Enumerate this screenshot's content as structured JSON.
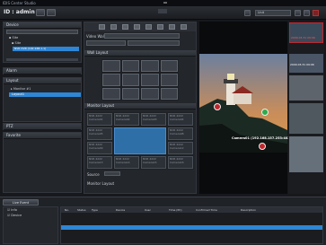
{
  "app": {
    "title": "IDIS Center Studio"
  },
  "topbar": {
    "id_label": "ID : admin",
    "user_value": "Unit"
  },
  "device_panel": {
    "title": "Device",
    "items": [
      {
        "label": "Site"
      },
      {
        "label": "Site"
      },
      {
        "label": "NVR DVR (192.168.1.1)"
      }
    ]
  },
  "side_sections": {
    "alarm": "Alarm",
    "layout": "Layout",
    "layout_items": [
      "Monitor #1",
      "Layout1"
    ],
    "ptz": "PTZ",
    "favorite": "Favorite"
  },
  "video_wall": {
    "label": "Video Wall",
    "layout_label": "Wall Layout"
  },
  "monitor_layout": {
    "label": "Monitor Layout",
    "cells": [
      "NVR 4222 Camera01",
      "NVR 4222 Camera02",
      "NVR 4222 Camera03",
      "NVR 4222 Camera04",
      "NVR 4222 Camera05",
      "",
      "",
      "NVR 4222 Camera08",
      "NVR 4222 Camera09",
      "",
      "",
      "NVR 4222 Camera12",
      "NVR 4222 Camera13",
      "NVR 4222 Camera14",
      "NVR 4222 Camera15",
      "NVR 4222 Camera16"
    ]
  },
  "source": {
    "label": "Source",
    "label2": "Monitor Layout"
  },
  "video": {
    "camera_caption": "Camera01 (192.168.157.253:4028)"
  },
  "thumbnails": [
    {
      "caption": "2009.03.31 09:06"
    },
    {
      "caption": "2009.03.31 09:06"
    },
    {
      "caption": ""
    },
    {
      "caption": ""
    },
    {
      "caption": ""
    }
  ],
  "event_panel": {
    "tab": "Live Event",
    "left_items": [
      "Info",
      "Device"
    ],
    "columns": [
      "No.",
      "Status",
      "Type",
      "Device",
      "User",
      "Time (PC)",
      "Confirmed Time",
      "Description"
    ]
  },
  "colors": {
    "accent": "#2e86d6",
    "selection": "#2e86d6",
    "red_close": "#c0272d"
  }
}
